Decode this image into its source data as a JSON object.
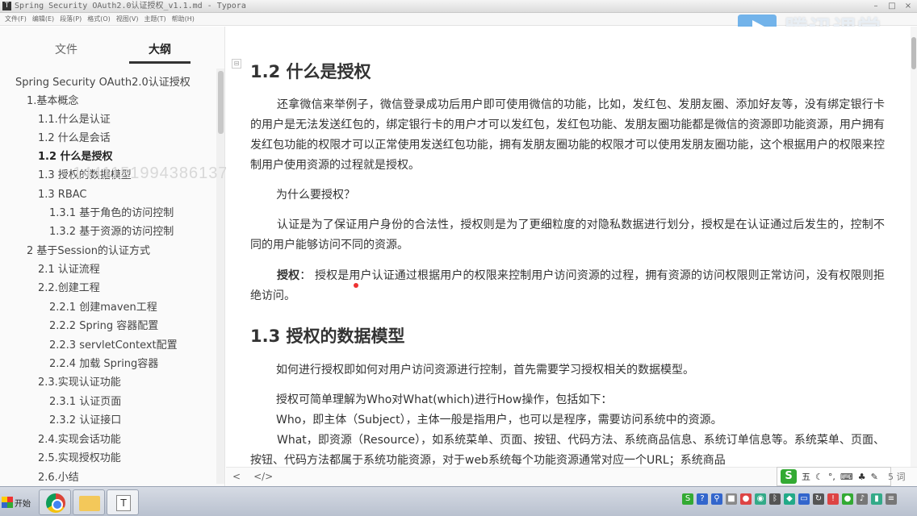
{
  "window": {
    "title": "Spring Security OAuth2.0认证授权_v1.1.md - Typora",
    "app_icon": "T",
    "controls": [
      "–",
      "□",
      "×"
    ]
  },
  "menubar": [
    "文件(F)",
    "编辑(E)",
    "段落(P)",
    "格式(O)",
    "视图(V)",
    "主题(T)",
    "帮助(H)"
  ],
  "watermark": {
    "text": "腾讯课堂"
  },
  "sidebar": {
    "tab_files": "文件",
    "tab_outline": "大纲",
    "id_watermark": "144115199438613795",
    "outline": [
      "Spring Security OAuth2.0认证授权",
      "1.基本概念",
      "1.1.什么是认证",
      "1.2 什么是会话",
      "1.2 什么是授权",
      "1.3 授权的数据模型",
      "1.3 RBAC",
      "1.3.1 基于角色的访问控制",
      "1.3.2 基于资源的访问控制",
      "2 基于Session的认证方式",
      "2.1 认证流程",
      "2.2.创建工程",
      "2.2.1 创建maven工程",
      "2.2.2 Spring 容器配置",
      "2.2.3 servletContext配置",
      "2.2.4 加载 Spring容器",
      "2.3.实现认证功能",
      "2.3.1 认证页面",
      "2.3.2 认证接口",
      "2.4.实现会话功能",
      "2.5.实现授权功能",
      "2.6.小结"
    ]
  },
  "editor": {
    "heading_1_2": "1.2 什么是授权",
    "p1": "还拿微信来举例子，微信登录成功后用户即可使用微信的功能，比如，发红包、发朋友圈、添加好友等，没有绑定银行卡的用户是无法发送红包的，绑定银行卡的用户才可以发红包，发红包功能、发朋友圈功能都是微信的资源即功能资源，用户拥有发红包功能的权限才可以正常使用发送红包功能，拥有发朋友圈功能的权限才可以使用发朋友圈功能，这个根据用户的权限来控制用户使用资源的过程就是授权。",
    "p2": "为什么要授权？",
    "p3": "认证是为了保证用户身份的合法性，授权则是为了更细粒度的对隐私数据进行划分，授权是在认证通过后发生的，控制不同的用户能够访问不同的资源。",
    "p4_bold": "授权",
    "p4_rest": "： 授权是用户认证通过根据用户的权限来控制用户访问资源的过程，拥有资源的访问权限则正常访问，没有权限则拒绝访问。",
    "heading_1_3": "1.3 授权的数据模型",
    "p5": "如何进行授权即如何对用户访问资源进行控制，首先需要学习授权相关的数据模型。",
    "p6": "授权可简单理解为Who对What(which)进行How操作，包括如下：",
    "p7": "Who，即主体（Subject），主体一般是指用户，也可以是程序，需要访问系统中的资源。",
    "p8": "What，即资源（Resource），如系统菜单、页面、按钮、代码方法、系统商品信息、系统订单信息等。系统菜单、页面、按钮、代码方法都属于系统功能资源，对于web系统每个功能资源通常对应一个URL；系统商品"
  },
  "statusbar": {
    "back": "<",
    "source": "</>",
    "word_count": "5 词"
  },
  "ime": {
    "logo": "S",
    "mode": "五"
  },
  "taskbar": {
    "start": "开始",
    "typora_icon": "T"
  }
}
